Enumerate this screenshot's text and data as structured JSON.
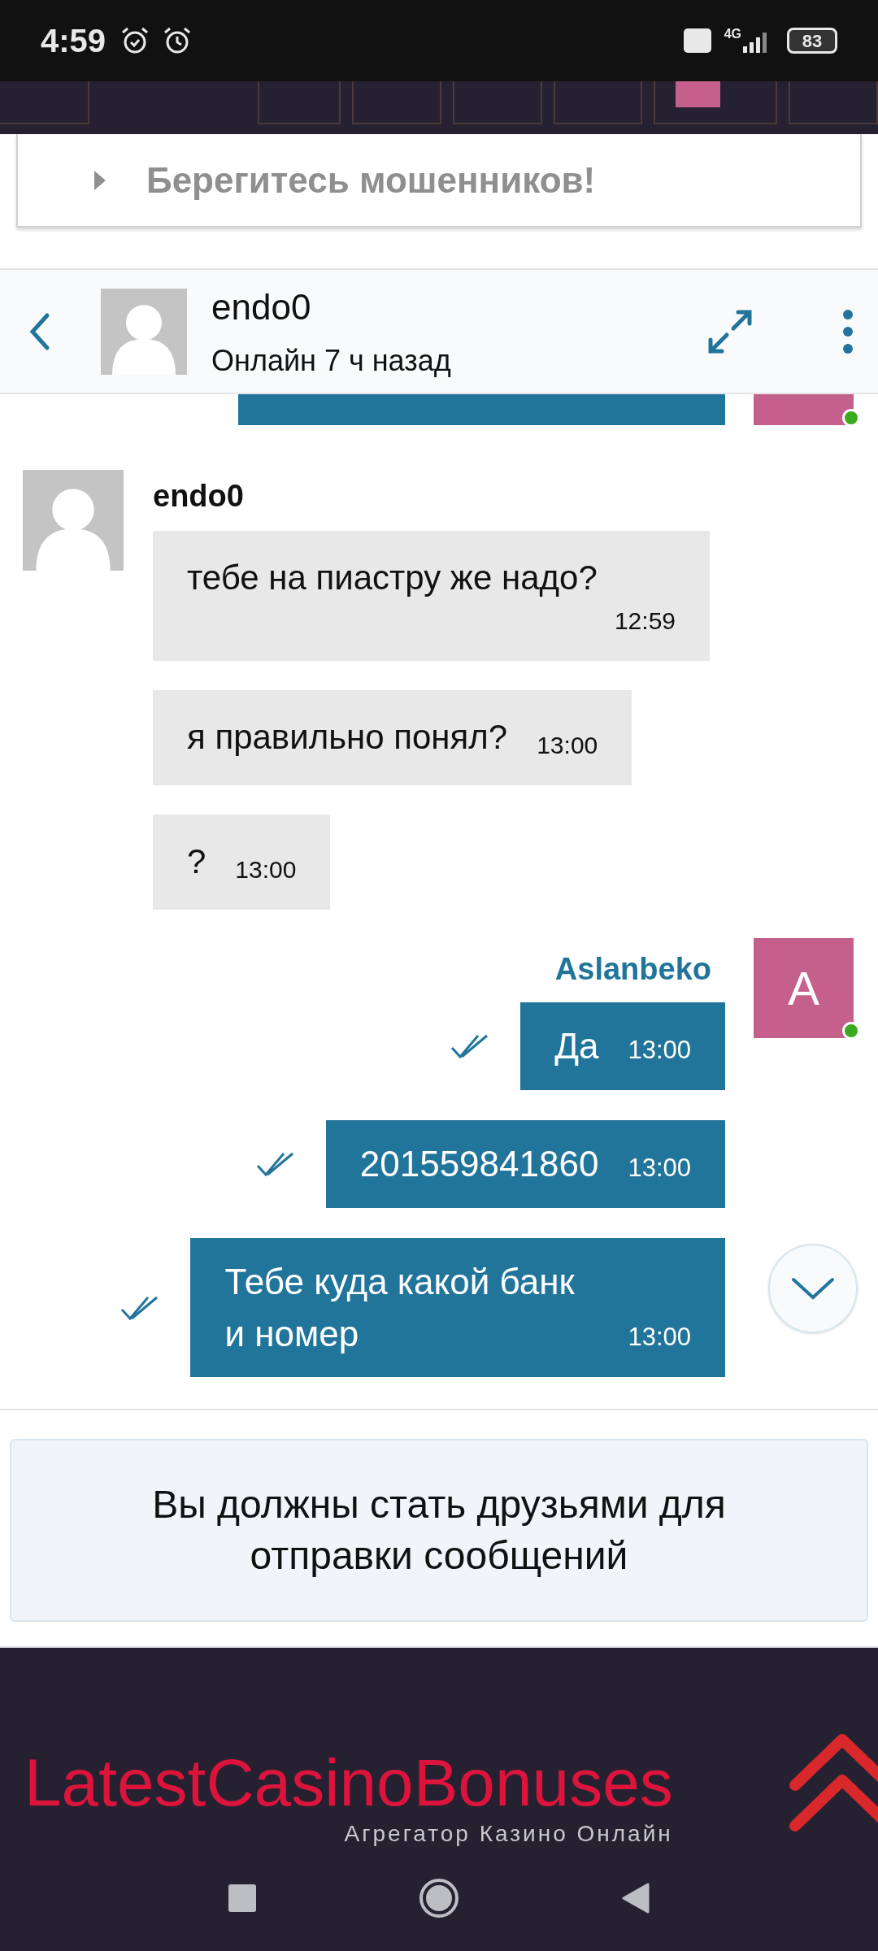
{
  "status_bar": {
    "time": "4:59",
    "network": "4G",
    "battery": "83"
  },
  "warning": {
    "title": "Берегитесь мошенников!",
    "expanded": false
  },
  "chat_header": {
    "name": "endo0",
    "status": "Онлайн 7 ч назад"
  },
  "groups": [
    {
      "kind": "incoming",
      "sender": "endo0",
      "messages": [
        {
          "text": "тебе на пиастру же надо?",
          "time": "12:59"
        },
        {
          "text": "я правильно понял?",
          "time": "13:00"
        },
        {
          "text": "?",
          "time": "13:00"
        }
      ]
    },
    {
      "kind": "outgoing",
      "sender": "Aslanbeko",
      "avatar_letter": "A",
      "online": true,
      "messages": [
        {
          "text": "Да",
          "time": "13:00",
          "read": true
        },
        {
          "text": "201559841860",
          "time": "13:00",
          "read": true
        },
        {
          "text": "Тебе куда какой банк и номер",
          "time": "13:00",
          "read": true
        }
      ]
    }
  ],
  "notice": "Вы должны стать друзьями для отправки сообщений",
  "footer": {
    "logo": "LatestCasinoBonuses",
    "tagline": "Агрегатор Казино Онлайн"
  }
}
